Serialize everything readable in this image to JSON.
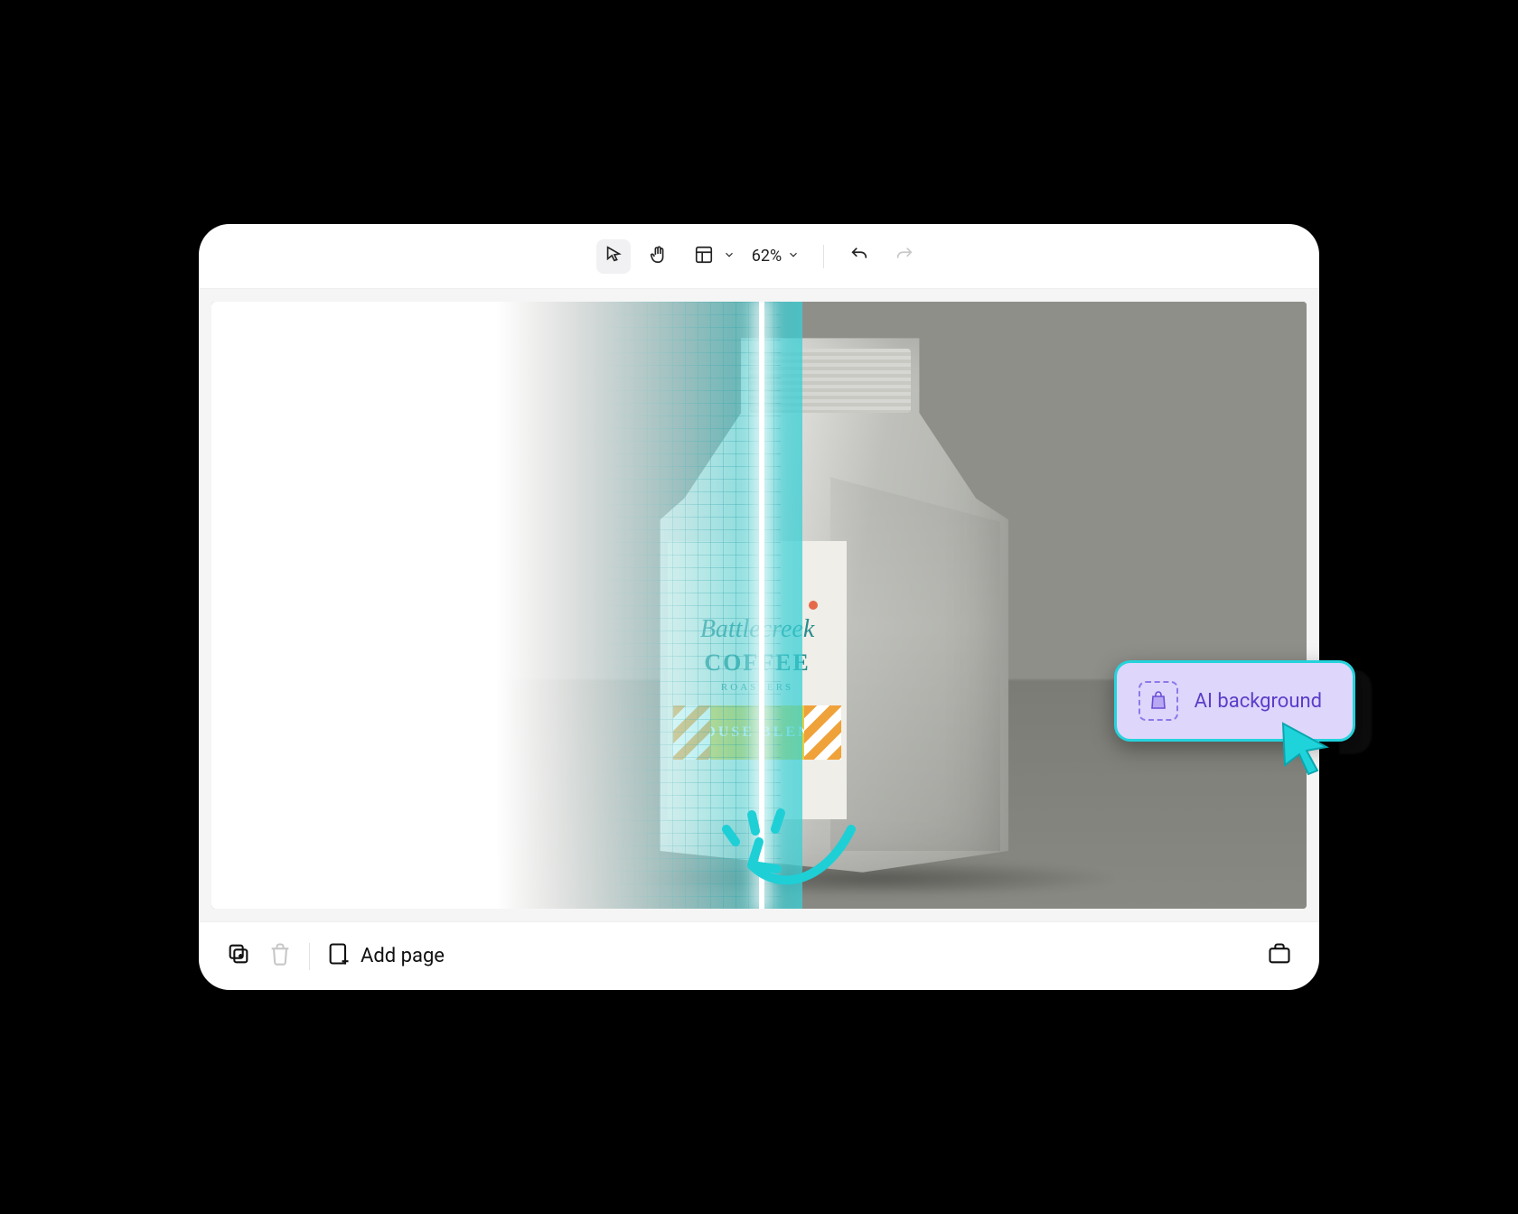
{
  "toolbar": {
    "zoom_label": "62%"
  },
  "bottom": {
    "add_page_label": "Add page"
  },
  "ai_chip": {
    "label": "AI background"
  },
  "product": {
    "brand_script": "Battlecreek",
    "brand_block": "COFFEE",
    "roasters_line": "ROASTERS",
    "blend_label": "HOUSE BLEND"
  },
  "colors": {
    "accent_cyan": "#24d3db",
    "chip_bg": "#ded6fb",
    "chip_text": "#5a3ec8"
  }
}
